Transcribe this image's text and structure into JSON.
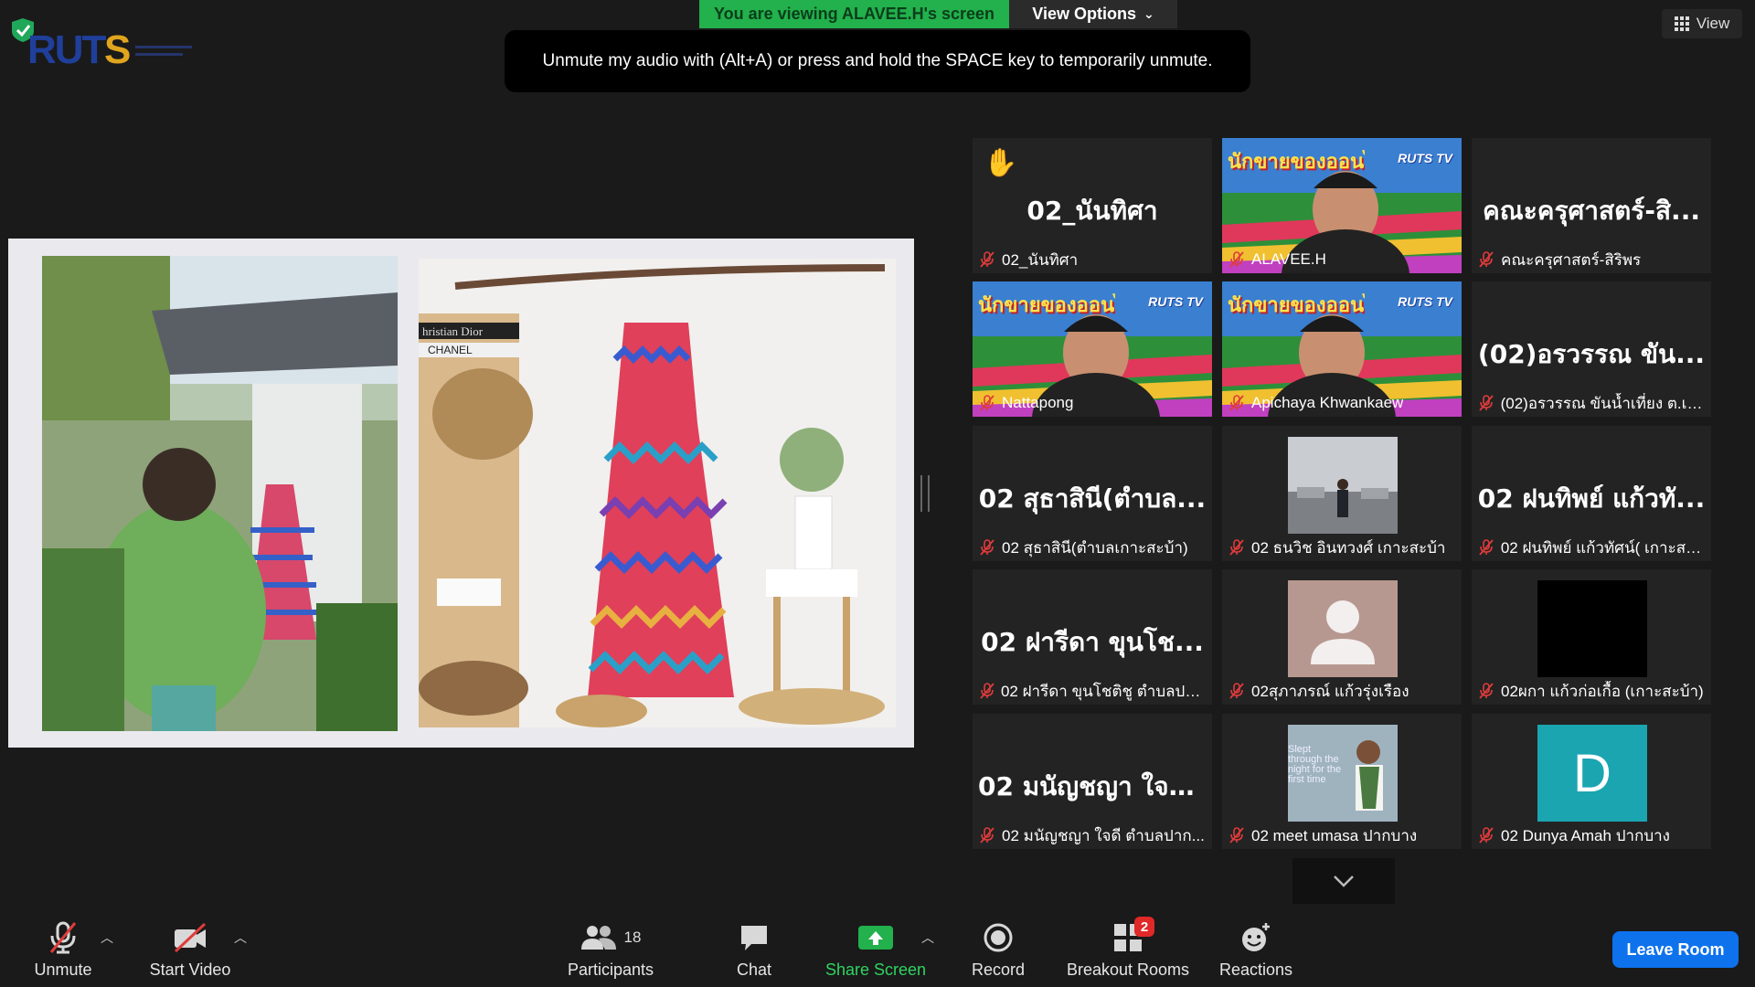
{
  "top": {
    "banner": "You are viewing ALAVEE.H's screen",
    "view_options": "View Options",
    "tooltip": "Unmute my audio with (Alt+A) or press and hold the SPACE key to temporarily unmute.",
    "view_button": "View"
  },
  "logo": {
    "text": "RUTS"
  },
  "slide": {
    "left_photo": "woman photographing dress",
    "right_photo": "zigzag dress on hanger",
    "book_labels": [
      "Christian Dior",
      "CHANEL"
    ]
  },
  "tiles": [
    {
      "big": "02_นันทิศา",
      "caption": "02_นันทิศา",
      "hand": "✋"
    },
    {
      "caption": "ALAVEE.H",
      "overlay": "นักขายของออนไลน์",
      "tag": "RUTS TV"
    },
    {
      "big": "คณะครุศาสตร์-สิ...",
      "caption": "คณะครุศาสตร์-สิริพร"
    },
    {
      "caption": "Nattapong",
      "overlay": "นักขายของออนไลน์",
      "tag": "RUTS TV"
    },
    {
      "caption": "Apichaya Khwankaew",
      "overlay": "นักขายของออนไลน์",
      "tag": "RUTS TV"
    },
    {
      "big": "(02)อรวรรณ ขัน...",
      "caption": "(02)อรวรรณ ขันน้ำเที่ยง ต.เก..."
    },
    {
      "big": "02 สุธาสินี(ตำบล...",
      "caption": "02 สุธาสินี(ตำบลเกาะสะบ้า)"
    },
    {
      "caption": "02 ธนวิช อินทวงศ์ เกาะสะบ้า"
    },
    {
      "big": "02 ฝนทิพย์ แก้วทั...",
      "caption": "02 ฝนทิพย์ แก้วทัศน์( เกาะสะ..."
    },
    {
      "big": "02 ฝารีดา ขุนโช...",
      "caption": "02 ฝารีดา ขุนโชติชู ตำบลปาก..."
    },
    {
      "caption": "02สุภาภรณ์ แก้วรุ่งเรือง"
    },
    {
      "caption": "02ผกา แก้วก่อเกื้อ (เกาะสะบ้า)"
    },
    {
      "big": "02 มนัญชญา ใจดี...",
      "caption": "02 มนัญชญา ใจดี ตำบลปาก..."
    },
    {
      "caption": "02 meet umasa ปากบาง",
      "photo_text": "Slept through the night for the first time"
    },
    {
      "caption": "02 Dunya Amah ปากบาง",
      "initial": "D"
    }
  ],
  "toolbar": {
    "unmute": "Unmute",
    "start_video": "Start Video",
    "participants": "Participants",
    "participants_count": "18",
    "chat": "Chat",
    "share_screen": "Share Screen",
    "record": "Record",
    "breakout_rooms": "Breakout Rooms",
    "breakout_badge": "2",
    "reactions": "Reactions",
    "leave": "Leave Room"
  },
  "colors": {
    "banner": "#22b14c",
    "highlight": "#c6d94a",
    "leave": "#0e72ed",
    "muted": "#e03b3b",
    "avatar_d": "#1aa5b1"
  }
}
